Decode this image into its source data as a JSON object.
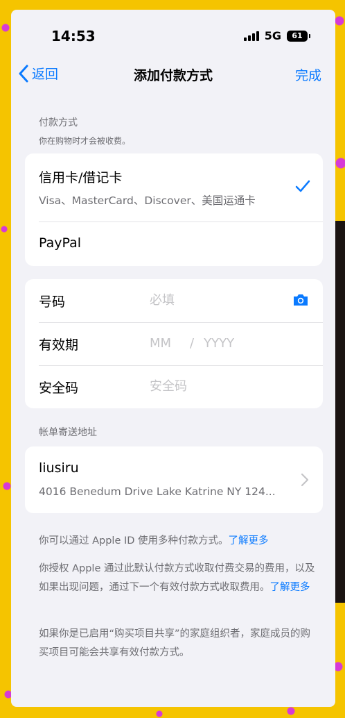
{
  "status_bar": {
    "time": "14:53",
    "network": "5G",
    "battery": "61"
  },
  "nav": {
    "back_label": "返回",
    "title": "添加付款方式",
    "done_label": "完成"
  },
  "payment_section": {
    "header": "付款方式",
    "subheader": "你在购物时才会被收费。",
    "methods": [
      {
        "title": "信用卡/借记卡",
        "subtitle": "Visa、MasterCard、Discover、美国运通卡",
        "selected": true
      },
      {
        "title": "PayPal"
      }
    ]
  },
  "card_fields": {
    "number_label": "号码",
    "number_placeholder": "必填",
    "expiry_label": "有效期",
    "expiry_month_placeholder": "MM",
    "expiry_separator": "/",
    "expiry_year_placeholder": "YYYY",
    "cvv_label": "安全码",
    "cvv_placeholder": "安全码"
  },
  "billing": {
    "header": "帐单寄送地址",
    "name": "liusiru",
    "address": "4016 Benedum Drive Lake Katrine NY 124..."
  },
  "footnotes": {
    "note1_text": "你可以通过 Apple ID 使用多种付款方式。",
    "note1_link": "了解更多",
    "note2_text": "你授权 Apple 通过此默认付款方式收取付费交易的费用，以及如果出现问题，通过下一个有效付款方式收取费用。",
    "note2_link": "了解更多",
    "note3_text": "如果你是已启用“购买项目共享”的家庭组织者，家庭成员的购买项目可能会共享有效付款方式。"
  },
  "colors": {
    "accent": "#0a7aff",
    "background": "#f2f2f7",
    "frame": "#f5c400",
    "dots": "#d63ad6"
  },
  "icons": {
    "back": "chevron-left-icon",
    "check": "checkmark-icon",
    "camera": "camera-icon",
    "chevron": "chevron-right-icon"
  }
}
